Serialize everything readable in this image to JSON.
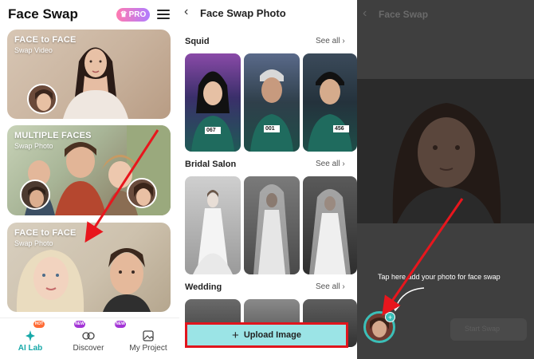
{
  "home": {
    "app_title": "Face Swap",
    "pro_label": "PRO",
    "cards": [
      {
        "title": "FACE to FACE",
        "subtitle": "Swap Video"
      },
      {
        "title": "MULTIPLE FACES",
        "subtitle": "Swap Photo"
      },
      {
        "title": "FACE to FACE",
        "subtitle": "Swap Photo"
      }
    ],
    "badges": [
      "HOT",
      "NEW",
      "NEW"
    ],
    "nav": [
      {
        "label": "AI Lab",
        "icon": "sparkle-icon",
        "active": true
      },
      {
        "label": "Discover",
        "icon": "discover-icon",
        "active": false
      },
      {
        "label": "My Project",
        "icon": "gallery-icon",
        "active": false
      }
    ]
  },
  "photo": {
    "title": "Face Swap Photo",
    "sections": [
      {
        "name": "Squid",
        "see_all": "See all",
        "labels": [
          "067",
          "001",
          "456"
        ]
      },
      {
        "name": "Bridal Salon",
        "see_all": "See all"
      },
      {
        "name": "Wedding",
        "see_all": "See all"
      }
    ],
    "upload_button": "Upload Image"
  },
  "preview": {
    "title": "Face Swap",
    "hint": "Tap here add your photo for face swap",
    "action_button": "Start Swap"
  },
  "colors": {
    "accent": "#3bbfb8",
    "upload_bg": "#9be4e6",
    "highlight_red": "#e0151d",
    "nav_active": "#18a9a9"
  }
}
